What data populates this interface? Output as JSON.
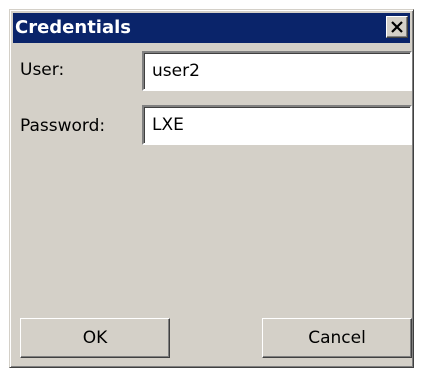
{
  "window": {
    "title": "Credentials",
    "close_icon": "close-x-icon"
  },
  "form": {
    "user_label": "User:",
    "user_value": "user2",
    "password_label": "Password:",
    "password_value": "LXE"
  },
  "buttons": {
    "ok_label": "OK",
    "cancel_label": "Cancel"
  },
  "colors": {
    "titlebar": "#0a246a",
    "face": "#d4d0c8"
  }
}
